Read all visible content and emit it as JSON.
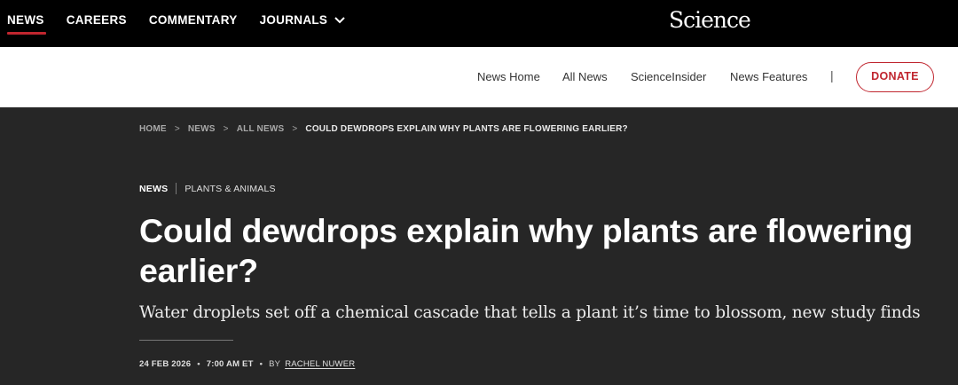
{
  "top_nav": {
    "items": [
      {
        "label": "NEWS",
        "active": true
      },
      {
        "label": "CAREERS"
      },
      {
        "label": "COMMENTARY"
      },
      {
        "label": "JOURNALS"
      }
    ],
    "journals_icon": "chevron-down-icon",
    "logo": "Science",
    "active_color": "#c0262f"
  },
  "sub_nav": {
    "items": [
      "News Home",
      "All News",
      "ScienceInsider",
      "News Features"
    ],
    "divider": "|",
    "donate_label": "DONATE",
    "donate_color": "#c0262f"
  },
  "breadcrumb": {
    "items": [
      "HOME",
      "NEWS",
      "ALL NEWS",
      "COULD DEWDROPS EXPLAIN WHY PLANTS ARE FLOWERING EARLIER?"
    ],
    "separator": ">"
  },
  "article": {
    "category": "NEWS",
    "topic": "PLANTS & ANIMALS",
    "title": "Could dewdrops explain why plants are flowering earlier?",
    "dek": "Water droplets set off a chemical cascade that tells a plant it’s time to blossom, new study finds",
    "date": "24 FEB 2026",
    "time": "7:00 AM ET",
    "by": "BY",
    "author": "RACHEL NUWER",
    "meta_separator": "•"
  }
}
